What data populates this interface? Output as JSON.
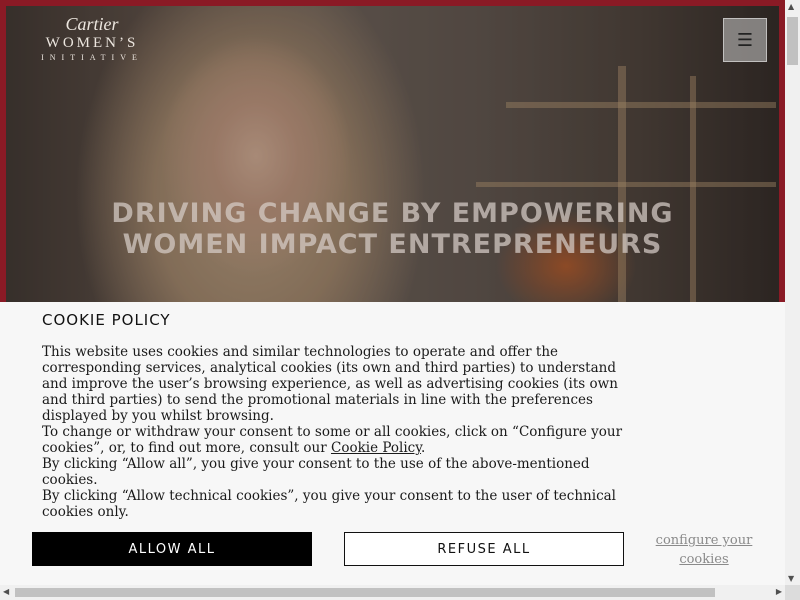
{
  "brand": {
    "line1": "Cartier",
    "line2": "WOMEN’S",
    "line3": "INITIATIVE"
  },
  "header": {
    "menu_icon": "hamburger-icon",
    "menu_glyph": "☰"
  },
  "hero": {
    "headline_line1": "DRIVING CHANGE BY EMPOWERING",
    "headline_line2": "WOMEN IMPACT ENTREPRENEURS"
  },
  "cookie": {
    "title": "COOKIE POLICY",
    "para1": "This website uses cookies and similar technologies to operate and offer the corresponding services, analytical cookies (its own and third parties) to understand and improve the user’s browsing experience, as well as advertising cookies (its own and third parties) to send the promotional materials in line with the preferences displayed by you whilst browsing.",
    "para2_before": "To change or withdraw your consent to some or all cookies, click on “Configure your cookies”, or, to find out more, consult our ",
    "para2_link": "Cookie Policy",
    "para2_after": ".",
    "para3": "By clicking “Allow all”, you give your consent to the use of the above-mentioned cookies.",
    "para4": "By clicking “Allow technical cookies”, you give your consent to the user of technical cookies only.",
    "allow_label": "ALLOW ALL",
    "refuse_label": "REFUSE ALL",
    "configure_label": "configure your cookies"
  },
  "scrollbars": {
    "up": "▲",
    "down": "▼",
    "left": "◀",
    "right": "▶"
  }
}
